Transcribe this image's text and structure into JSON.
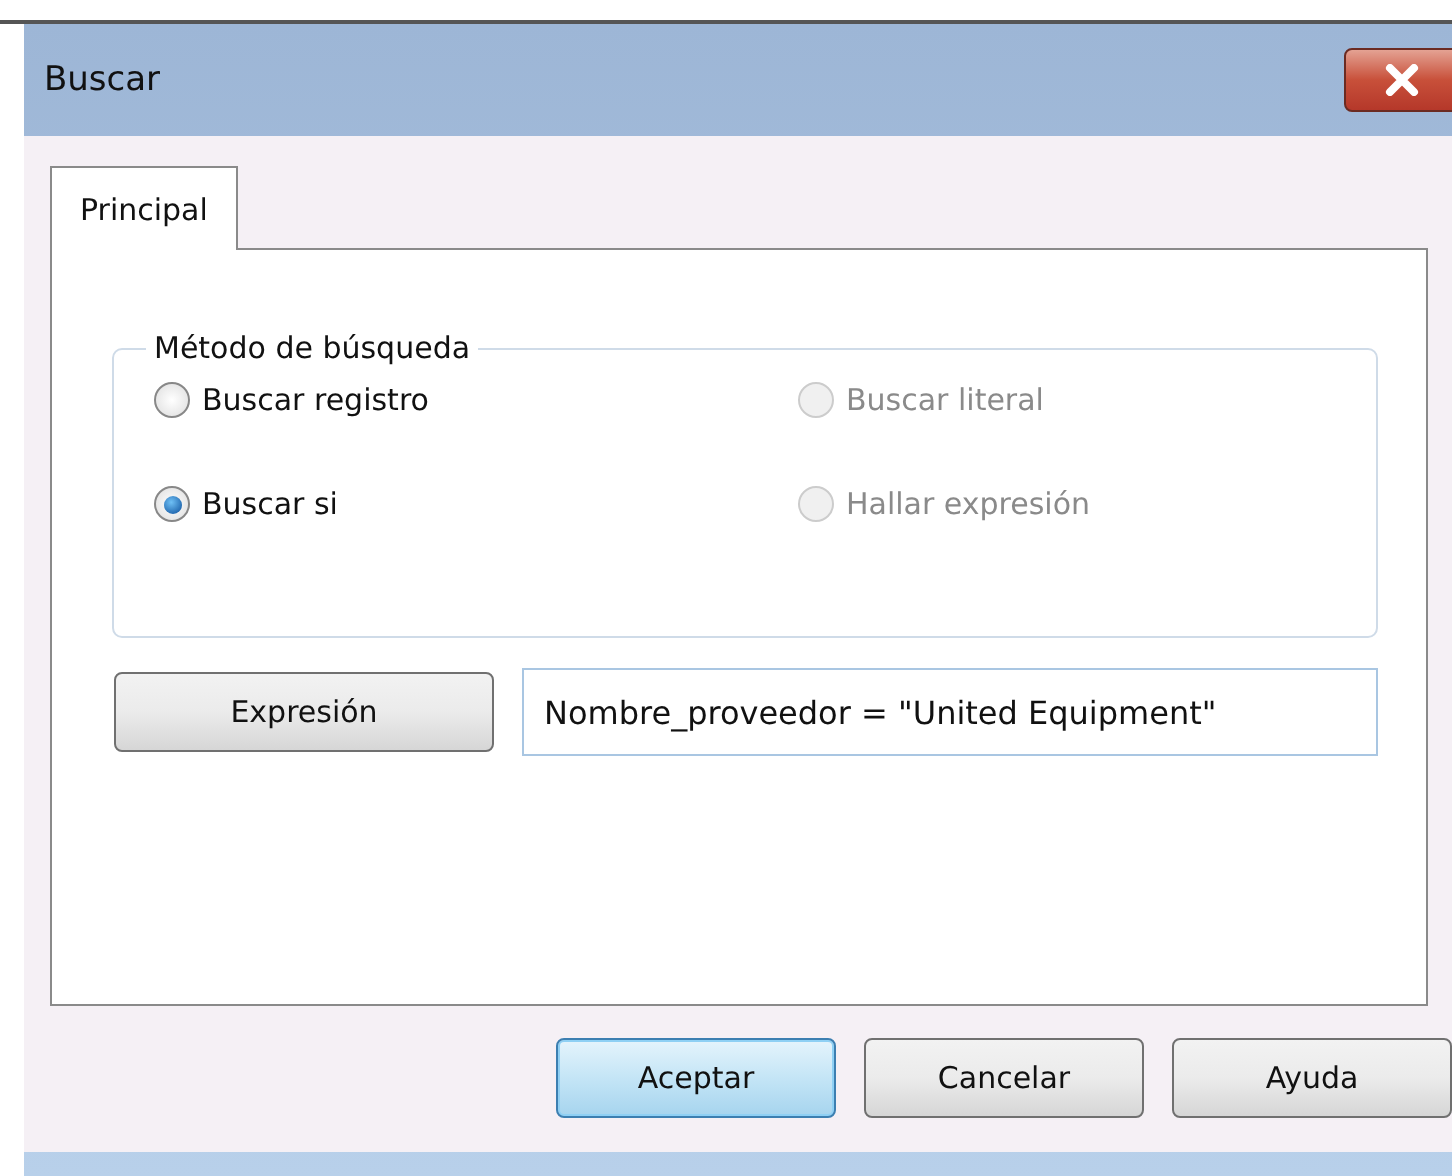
{
  "window": {
    "title": "Buscar"
  },
  "tabs": [
    {
      "label": "Principal",
      "selected": true
    }
  ],
  "search_method": {
    "title": "Método de búsqueda",
    "options": [
      {
        "label": "Buscar registro",
        "selected": false,
        "disabled": false
      },
      {
        "label": "Buscar literal",
        "selected": false,
        "disabled": true
      },
      {
        "label": "Buscar si",
        "selected": true,
        "disabled": false
      },
      {
        "label": "Hallar expresión",
        "selected": false,
        "disabled": true
      }
    ]
  },
  "expression": {
    "button": "Expresión",
    "value": "Nombre_proveedor = \"United Equipment\""
  },
  "buttons": [
    {
      "label": "Aceptar",
      "default": true
    },
    {
      "label": "Cancelar",
      "default": false
    },
    {
      "label": "Ayuda",
      "default": false
    }
  ]
}
